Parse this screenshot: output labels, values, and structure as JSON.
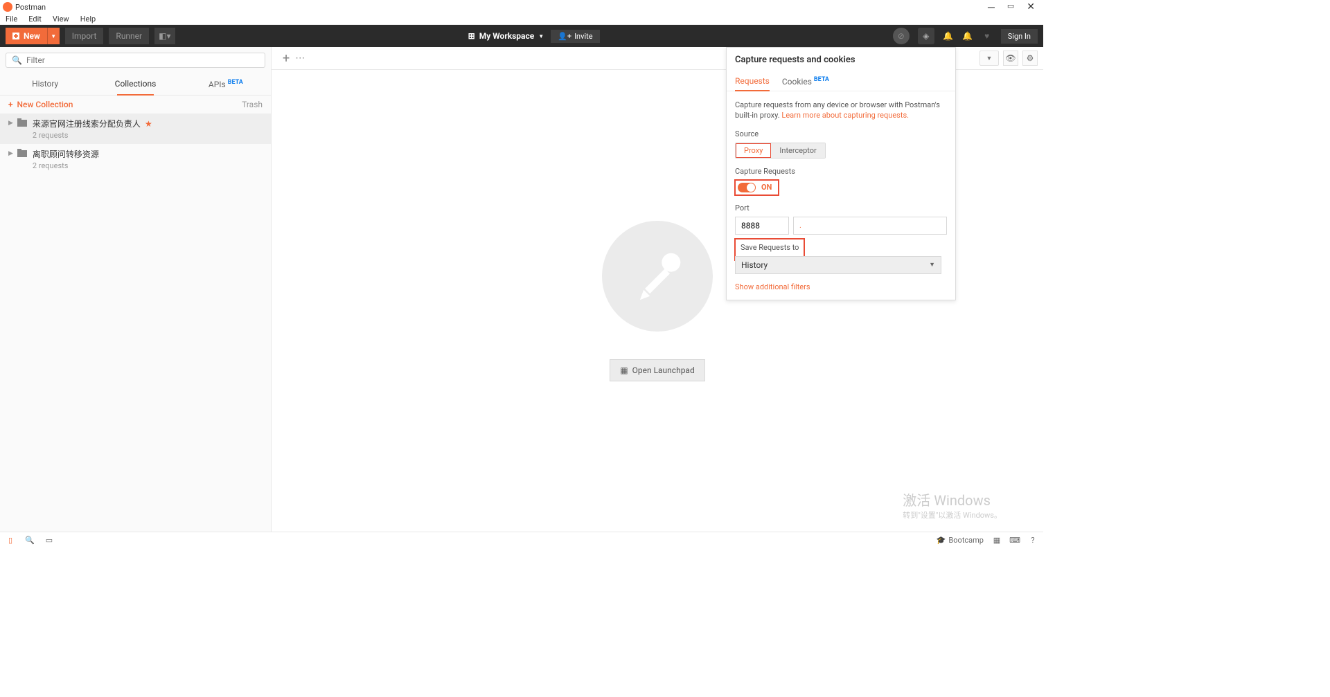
{
  "titlebar": {
    "title": "Postman"
  },
  "menubar": {
    "file": "File",
    "edit": "Edit",
    "view": "View",
    "help": "Help"
  },
  "toolbar": {
    "new": "New",
    "import": "Import",
    "runner": "Runner",
    "workspace": "My Workspace",
    "invite": "Invite",
    "signin": "Sign In"
  },
  "sidebar": {
    "filter_placeholder": "Filter",
    "tabs": {
      "history": "History",
      "collections": "Collections",
      "apis": "APIs",
      "apis_badge": "BETA"
    },
    "new_collection": "New Collection",
    "trash": "Trash",
    "collections": [
      {
        "name": "来源官网注册线索分配负责人",
        "meta": "2 requests",
        "starred": true
      },
      {
        "name": "离职顾问转移资源",
        "meta": "2 requests",
        "starred": false
      }
    ]
  },
  "content": {
    "open_launchpad": "Open Launchpad"
  },
  "capture": {
    "title": "Capture requests and cookies",
    "tabs": {
      "requests": "Requests",
      "cookies": "Cookies",
      "cookies_badge": "BETA"
    },
    "desc": "Capture requests from any device or browser with Postman's built-in proxy. ",
    "learn_more": "Learn more about capturing requests.",
    "source_label": "Source",
    "source_proxy": "Proxy",
    "source_interceptor": "Interceptor",
    "capture_requests_label": "Capture Requests",
    "toggle_label": "ON",
    "port_label": "Port",
    "port_value": "8888",
    "port_display": ".",
    "save_label": "Save Requests to",
    "save_value": "History",
    "show_filters": "Show additional filters"
  },
  "statusbar": {
    "bootcamp": "Bootcamp"
  },
  "watermark": {
    "line1": "激活 Windows",
    "line2": "转到\"设置\"以激活 Windows。"
  }
}
